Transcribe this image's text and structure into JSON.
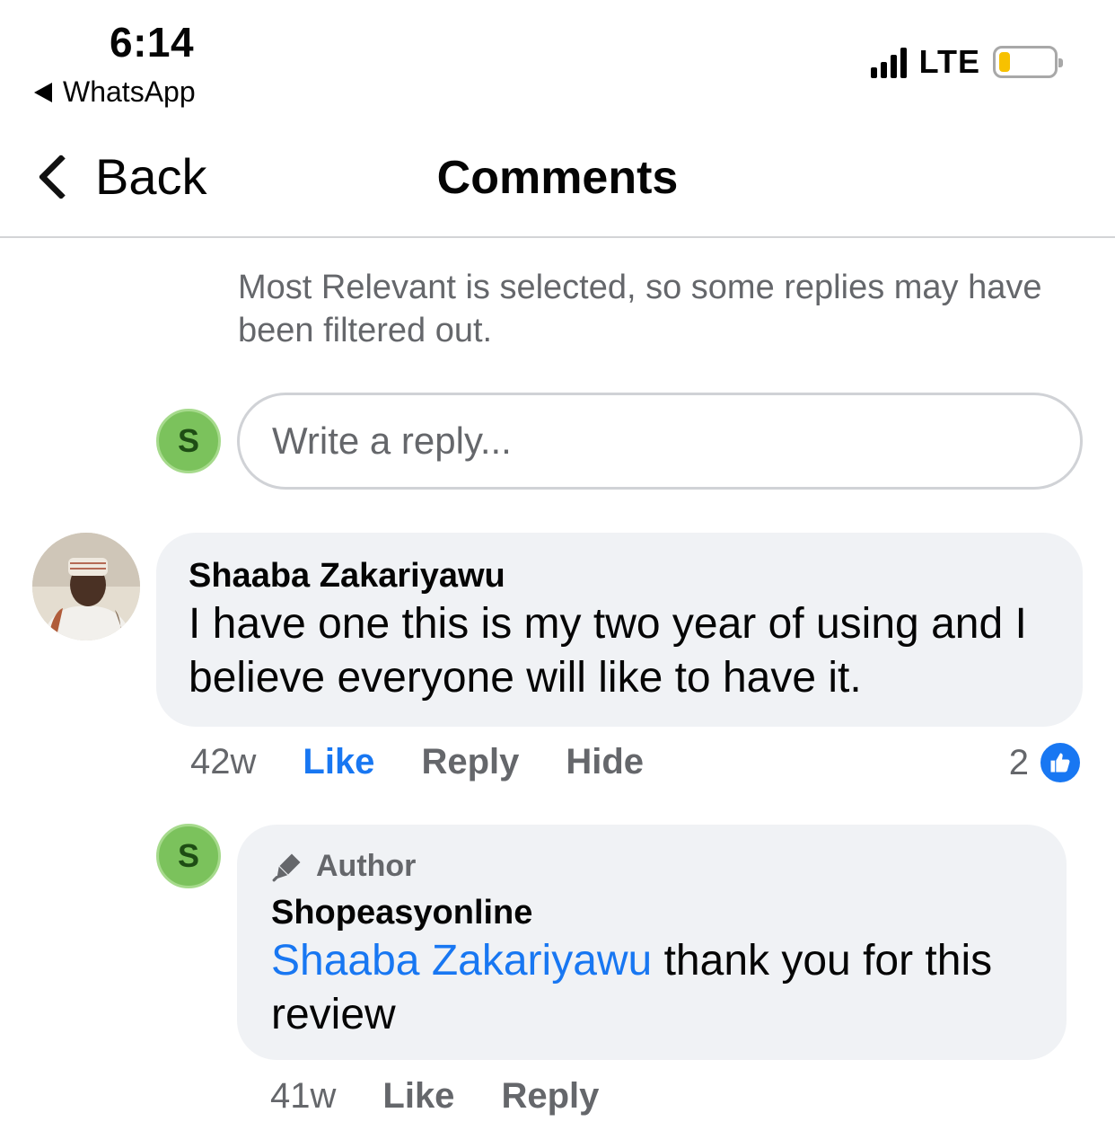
{
  "status_bar": {
    "time": "6:14",
    "back_app": "WhatsApp",
    "network": "LTE",
    "battery_level": 0.2,
    "battery_color": "#f7c100"
  },
  "nav": {
    "back_label": "Back",
    "title": "Comments"
  },
  "filter_note": "Most Relevant is selected, so some replies may have been filtered out.",
  "composer": {
    "avatar_initial": "S",
    "placeholder": "Write a reply..."
  },
  "comment": {
    "author": "Shaaba Zakariyawu",
    "text": "I have one this is my two year of using and I believe everyone will like to have it.",
    "time": "42w",
    "like_label": "Like",
    "reply_label": "Reply",
    "hide_label": "Hide",
    "like_count": "2",
    "like_icon": "thumbs-up-icon"
  },
  "reply": {
    "avatar_initial": "S",
    "badge_icon": "pen-icon",
    "badge": "Author",
    "author": "Shopeasyonline",
    "mention": "Shaaba Zakariyawu",
    "text": " thank you for this review",
    "time": "41w",
    "like_label": "Like",
    "reply_label": "Reply"
  },
  "colors": {
    "accent": "#1877f2",
    "bubble": "#f0f2f5",
    "muted_text": "#65676b",
    "avatar_green": "#7bc25c"
  }
}
